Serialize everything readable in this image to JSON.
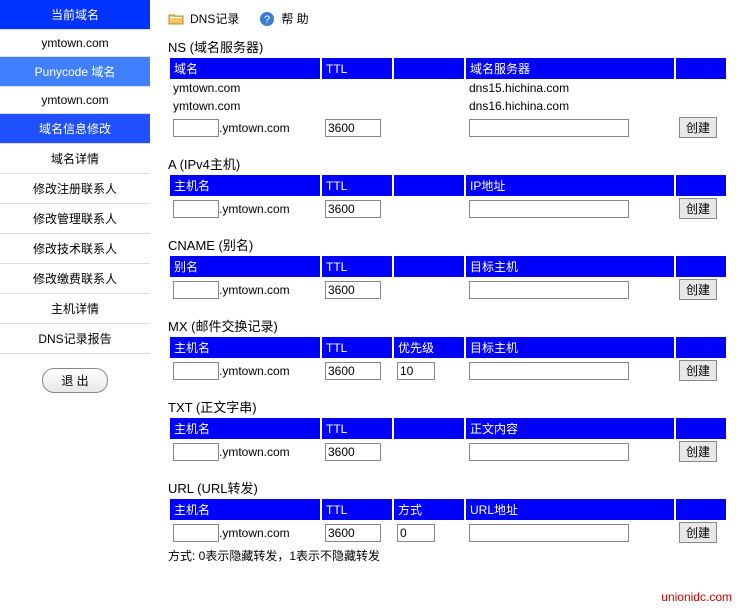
{
  "sidebar": {
    "items": [
      {
        "label": "当前域名",
        "cls": "nav-header"
      },
      {
        "label": "ymtown.com",
        "cls": "nav-plain"
      },
      {
        "label": "Punycode  域名",
        "cls": "nav-header light"
      },
      {
        "label": "ymtown.com",
        "cls": "nav-plain"
      },
      {
        "label": "域名信息修改",
        "cls": "nav-header sub"
      },
      {
        "label": "域名详情",
        "cls": "nav-plain"
      },
      {
        "label": "修改注册联系人",
        "cls": "nav-plain"
      },
      {
        "label": "修改管理联系人",
        "cls": "nav-plain"
      },
      {
        "label": "修改技术联系人",
        "cls": "nav-plain"
      },
      {
        "label": "修改缴费联系人",
        "cls": "nav-plain"
      },
      {
        "label": "主机详情",
        "cls": "nav-plain"
      },
      {
        "label": "DNS记录报告",
        "cls": "nav-plain"
      }
    ],
    "logout": "退 出"
  },
  "topbar": {
    "dns_records": "DNS记录",
    "help": "帮 助"
  },
  "common": {
    "domain_suffix": ".ymtown.com",
    "create": "创建"
  },
  "ns": {
    "title": "NS (域名服务器)",
    "cols": [
      "域名",
      "TTL",
      "",
      "域名服务器",
      ""
    ],
    "rows": [
      {
        "domain": "ymtown.com",
        "server": "dns15.hichina.com"
      },
      {
        "domain": "ymtown.com",
        "server": "dns16.hichina.com"
      }
    ],
    "ttl_default": "3600"
  },
  "a": {
    "title": "A (IPv4主机)",
    "cols": [
      "主机名",
      "TTL",
      "",
      "IP地址",
      ""
    ],
    "ttl_default": "3600"
  },
  "cname": {
    "title": "CNAME (别名)",
    "cols": [
      "别名",
      "TTL",
      "",
      "目标主机",
      ""
    ],
    "ttl_default": "3600"
  },
  "mx": {
    "title": "MX (邮件交换记录)",
    "cols": [
      "主机名",
      "TTL",
      "优先级",
      "目标主机",
      ""
    ],
    "ttl_default": "3600",
    "priority_default": "10"
  },
  "txt": {
    "title": "TXT (正文字串)",
    "cols": [
      "主机名",
      "TTL",
      "",
      "正文内容",
      ""
    ],
    "ttl_default": "3600"
  },
  "url": {
    "title": "URL (URL转发)",
    "cols": [
      "主机名",
      "TTL",
      "方式",
      "URL地址",
      ""
    ],
    "ttl_default": "3600",
    "mode_default": "0",
    "footnote": "方式: 0表示隐藏转发，1表示不隐藏转发"
  },
  "watermark": "unionidc.com"
}
